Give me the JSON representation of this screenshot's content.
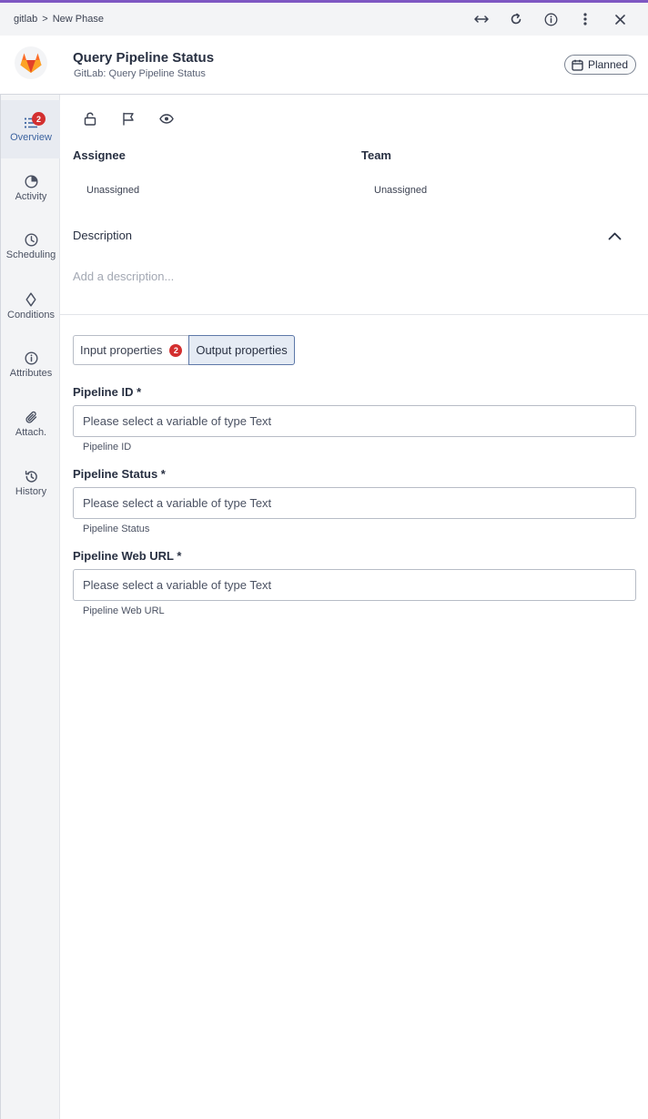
{
  "breadcrumb": {
    "root": "gitlab",
    "separator": ">",
    "current": "New Phase"
  },
  "top_actions": [
    {
      "icon": "expand-horizontal-icon"
    },
    {
      "icon": "refresh-icon"
    },
    {
      "icon": "info-icon"
    },
    {
      "icon": "more-vertical-icon"
    },
    {
      "icon": "close-icon"
    }
  ],
  "header": {
    "title": "Query Pipeline Status",
    "subtitle": "GitLab: Query Pipeline Status",
    "status": "Planned"
  },
  "sidebar": {
    "items": [
      {
        "label": "Overview",
        "icon": "list-icon",
        "badge": "2",
        "active": true
      },
      {
        "label": "Activity",
        "icon": "pie-icon"
      },
      {
        "label": "Scheduling",
        "icon": "clock-icon"
      },
      {
        "label": "Conditions",
        "icon": "diamond-icon"
      },
      {
        "label": "Attributes",
        "icon": "info-icon"
      },
      {
        "label": "Attach.",
        "icon": "paperclip-icon"
      },
      {
        "label": "History",
        "icon": "history-icon"
      }
    ]
  },
  "overview": {
    "icons": [
      "lock-icon",
      "flag-icon",
      "eye-icon"
    ],
    "assignee_label": "Assignee",
    "assignee_value": "Unassigned",
    "team_label": "Team",
    "team_value": "Unassigned",
    "description_label": "Description",
    "description_placeholder": "Add a description..."
  },
  "tabs": [
    {
      "label": "Input properties",
      "badge": "2"
    },
    {
      "label": "Output properties",
      "active": true
    }
  ],
  "properties": [
    {
      "label": "Pipeline ID *",
      "placeholder": "Please select a variable of type Text",
      "help": "Pipeline ID"
    },
    {
      "label": "Pipeline Status *",
      "placeholder": "Please select a variable of type Text",
      "help": "Pipeline Status"
    },
    {
      "label": "Pipeline Web URL *",
      "placeholder": "Please select a variable of type Text",
      "help": "Pipeline Web URL"
    }
  ],
  "colors": {
    "accent": "#7e57c2",
    "badge": "#d32f2f",
    "active": "#3d64a0"
  }
}
